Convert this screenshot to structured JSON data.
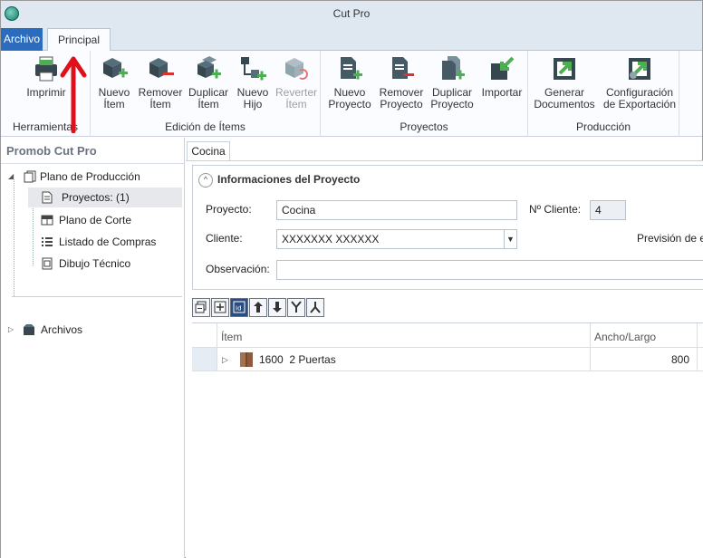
{
  "window": {
    "title": "Cut Pro"
  },
  "menu_tabs": {
    "archivo": "Archivo",
    "principal": "Principal"
  },
  "ribbon": {
    "herramientas": {
      "label": "Herramientas",
      "imprimir": "Imprimir"
    },
    "edicion": {
      "label": "Edición de Ítems",
      "nuevo_item": [
        "Nuevo",
        "Ítem"
      ],
      "remover_item": [
        "Remover",
        "Ítem"
      ],
      "duplicar_item": [
        "Duplicar",
        "Ítem"
      ],
      "nuevo_hijo": [
        "Nuevo",
        "Hijo"
      ],
      "revertir_item": [
        "Reverter",
        "Ítem"
      ]
    },
    "proyectos": {
      "label": "Proyectos",
      "nuevo_proyecto": [
        "Nuevo",
        "Proyecto"
      ],
      "remover_proyecto": [
        "Remover",
        "Proyecto"
      ],
      "duplicar_proyecto": [
        "Duplicar",
        "Proyecto"
      ],
      "importar": "Importar"
    },
    "produccion": {
      "label": "Producción",
      "generar_documentos": [
        "Generar",
        "Documentos"
      ],
      "configuracion_exportacion": [
        "Configuración",
        "de Exportación"
      ]
    }
  },
  "left_panel": {
    "title": "Promob Cut Pro",
    "tree": {
      "plano_produccion": "Plano de Producción",
      "proyectos": "Proyectos: (1)",
      "plano_corte": "Plano de Corte",
      "listado_compras": "Listado de Compras",
      "dibujo_tecnico": "Dibujo Técnico",
      "archivos": "Archivos"
    }
  },
  "document": {
    "tab": "Cocina",
    "section_title": "Informaciones del Proyecto",
    "fields": {
      "proyecto_label": "Proyecto:",
      "proyecto_value": "Cocina",
      "n_cliente_label": "Nº Cliente:",
      "n_cliente_value": "4",
      "cliente_label": "Cliente:",
      "cliente_value": "XXXXXXX XXXXXX",
      "prevision_label": "Previsión de e",
      "observacion_label": "Observación:",
      "observacion_value": ""
    },
    "grid": {
      "columns": [
        "Ítem",
        "Ancho/Largo"
      ],
      "rows": [
        {
          "item": "1600  2 Puertas",
          "ancho_largo": "800"
        }
      ]
    }
  },
  "colors": {
    "accent": "#2b6cbf",
    "annotation_arrow": "#e0101a",
    "green_icon": "#4caf50",
    "red_icon": "#d9312b"
  }
}
